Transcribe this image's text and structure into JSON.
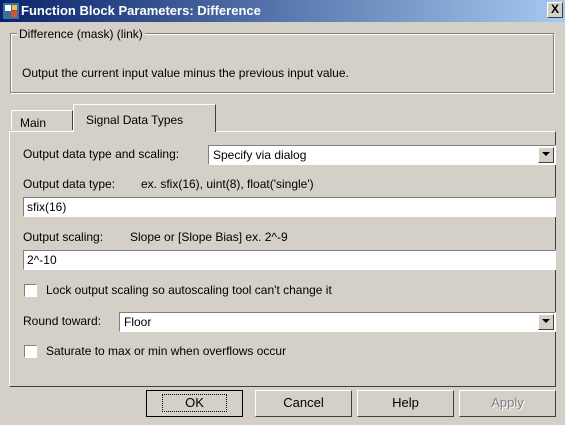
{
  "window": {
    "title": "Function Block Parameters: Difference",
    "close_glyph": "X"
  },
  "description": {
    "legend": "Difference (mask) (link)",
    "text": "Output the current input value minus the previous input value."
  },
  "tabs": [
    {
      "label": "Main",
      "active": false
    },
    {
      "label": "Signal Data Types",
      "active": true
    }
  ],
  "params": {
    "output_dtype_scaling_label": "Output data type and scaling:",
    "output_dtype_scaling_value": "Specify via dialog",
    "output_dtype_label": "Output data type:",
    "output_dtype_hint": "ex.  sfix(16),  uint(8),  float('single')",
    "output_dtype_value": "sfix(16)",
    "output_scaling_label": "Output scaling:",
    "output_scaling_hint": "Slope or [Slope Bias]   ex.  2^-9",
    "output_scaling_value": "2^-10",
    "lock_scaling_label": "Lock output scaling so autoscaling tool can't change it",
    "lock_scaling_checked": false,
    "round_toward_label": "Round toward:",
    "round_toward_value": "Floor",
    "saturate_label": "Saturate to max or min when overflows occur",
    "saturate_checked": false
  },
  "buttons": {
    "ok": "OK",
    "cancel": "Cancel",
    "help": "Help",
    "apply": "Apply"
  },
  "icons": {
    "app": "simulink-block-icon",
    "close": "close-icon",
    "dropdown": "chevron-down-icon"
  }
}
